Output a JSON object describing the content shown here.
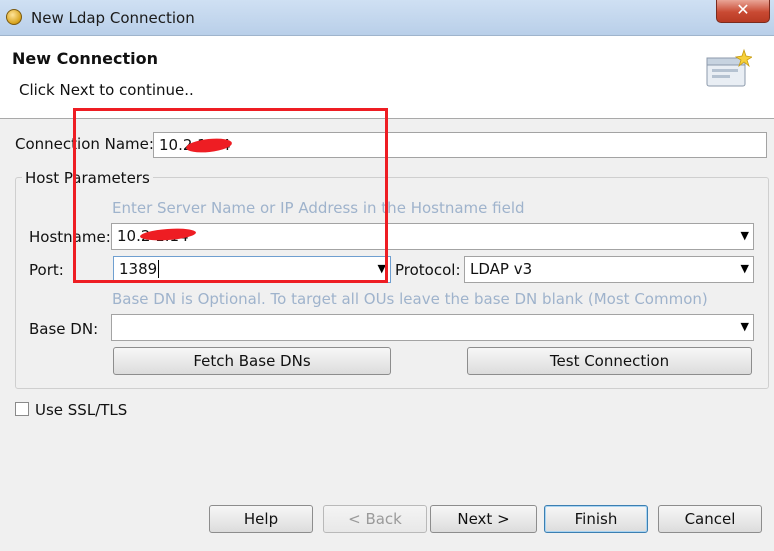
{
  "window": {
    "title": "New Ldap Connection",
    "close_glyph": "✕"
  },
  "banner": {
    "title": "New Connection",
    "subtitle": "Click Next to continue.."
  },
  "connection": {
    "label": "Connection Name:",
    "value": "10.2       1.14"
  },
  "host_params": {
    "legend": "Host Parameters",
    "hostname_hint": "Enter Server Name or IP Address in the Hostname field",
    "hostname_label": "Hostname:",
    "hostname_value": "10.2        1.14",
    "port_label": "Port:",
    "port_value": "1389",
    "protocol_label": "Protocol:",
    "protocol_value": "LDAP v3",
    "basedn_hint": "Base DN is Optional. To target all OUs leave the base DN blank (Most Common)",
    "basedn_label": "Base DN:",
    "basedn_value": "",
    "fetch_button": "Fetch Base DNs",
    "test_button": "Test Connection"
  },
  "ssl": {
    "label": "Use SSL/TLS",
    "checked": false
  },
  "footer": {
    "help": "Help",
    "back": "< Back",
    "next": "Next >",
    "finish": "Finish",
    "cancel": "Cancel"
  },
  "colors": {
    "hint": "#9fb3cc",
    "annotation": "#ee1d23"
  },
  "icons": {
    "app": "ldap-app-icon",
    "wizard": "new-connection-wizard-icon",
    "dropdown": "chevron-down-icon"
  }
}
